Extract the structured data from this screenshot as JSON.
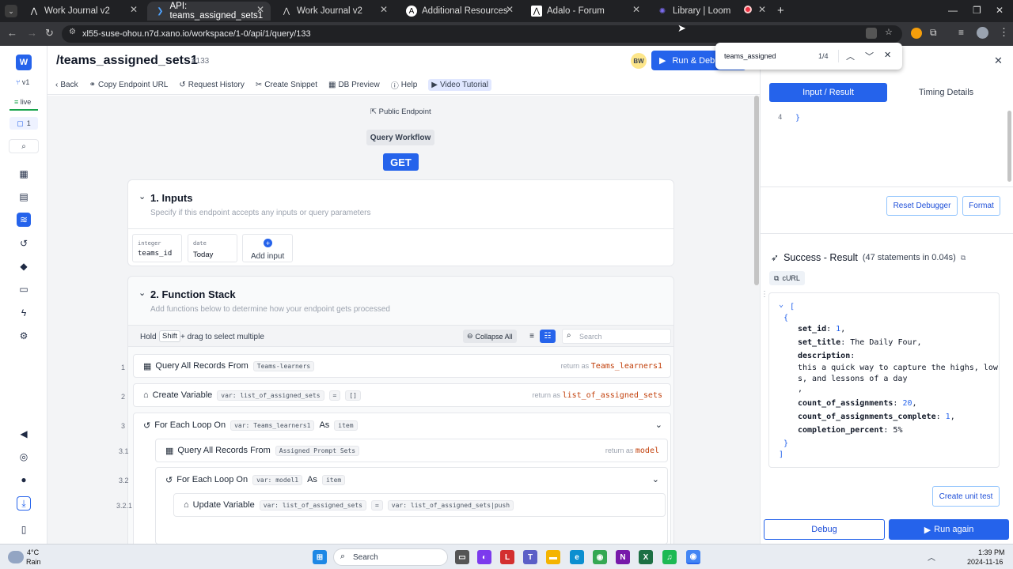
{
  "browser": {
    "tabs": [
      {
        "title": "Work Journal v2",
        "icon": "adalo-icon"
      },
      {
        "title": "API: teams_assigned_sets1",
        "icon": "xano-icon",
        "active": true
      },
      {
        "title": "Work Journal v2",
        "icon": "adalo-icon"
      },
      {
        "title": "Additional Resources | Adalo R",
        "icon": "adalo-icon"
      },
      {
        "title": "Adalo - Forum",
        "icon": "adalo-icon"
      },
      {
        "title": "Library | Loom",
        "icon": "loom-icon"
      }
    ],
    "url": "xl55-suse-ohou.n7d.xano.io/workspace/1-0/api/1/query/133"
  },
  "find": {
    "query": "teams_assigned",
    "count": "1/4"
  },
  "sidebar": {
    "workspace_letter": "W",
    "version": "v1",
    "status": "live",
    "badge_count": "1"
  },
  "header": {
    "title": "/teams_assigned_sets1",
    "id": "#133",
    "avatar": "BW",
    "run_debug": "Run & Debug"
  },
  "toolbar": {
    "back": "Back",
    "copy": "Copy Endpoint URL",
    "history": "Request History",
    "snippet": "Create Snippet",
    "db": "DB Preview",
    "help": "Help",
    "video": "Video Tutorial"
  },
  "canvas": {
    "public": "Public Endpoint",
    "workflow": "Query Workflow",
    "method": "GET",
    "inputs": {
      "title": "1. Inputs",
      "subtitle": "Specify if this endpoint accepts any inputs or query parameters",
      "fields": [
        {
          "type": "integer",
          "name": "teams_id"
        },
        {
          "type": "date",
          "name": "Today"
        }
      ],
      "add": "Add input"
    },
    "stack": {
      "title": "2. Function Stack",
      "subtitle": "Add functions below to determine how your endpoint gets processed",
      "hold": "Hold",
      "shift": "Shift",
      "drag": "+ drag to select multiple",
      "collapse": "Collapse All",
      "search_placeholder": "Search",
      "rows": [
        {
          "n": "1",
          "label": "Query All Records From",
          "tag": "Teams-learners",
          "ret": "return as",
          "retval": "Teams_learners1"
        },
        {
          "n": "2",
          "label": "Create Variable",
          "tag": "var: list_of_assigned_sets",
          "eq": "=",
          "tag2": "[]",
          "ret": "return as",
          "retval": "list_of_assigned_sets"
        },
        {
          "n": "3",
          "label": "For Each Loop On",
          "tag": "var: Teams_learners1",
          "as": "As",
          "tag2": "item"
        },
        {
          "n": "3.1",
          "label": "Query All Records From",
          "tag": "Assigned Prompt Sets",
          "ret": "return as",
          "retval": "model"
        },
        {
          "n": "3.2",
          "label": "For Each Loop On",
          "tag": "var: model1",
          "as": "As",
          "tag2": "item"
        },
        {
          "n": "3.2.1",
          "label": "Update Variable",
          "tag": "var: list_of_assigned_sets",
          "eq": "=",
          "tag2": "var: list_of_assigned_sets|push"
        }
      ]
    }
  },
  "panel": {
    "tab_input": "Input / Result",
    "tab_timing": "Timing Details",
    "code_line": "4",
    "code_text": "}",
    "reset": "Reset Debugger",
    "format": "Format",
    "success": "Success - Result",
    "stats": "(47 statements in 0.04s)",
    "curl": "cURL",
    "json": {
      "set_id_key": "set_id",
      "set_id": "1",
      "set_title_key": "set_title",
      "set_title": "The Daily Four,",
      "desc_key": "description",
      "desc1": "this a quick way to capture the highs, low",
      "desc2": "s, and lessons of a day",
      "coa_key": "count_of_assignments",
      "coa": "20",
      "coac_key": "count_of_assignments_complete",
      "coac": "1",
      "cp_key": "completion_percent",
      "cp": "5%"
    },
    "create_test": "Create unit test",
    "debug": "Debug",
    "run_again": "Run again"
  },
  "taskbar": {
    "temp": "4°C",
    "weather": "Rain",
    "search": "Search",
    "time": "1:39 PM",
    "date": "2024-11-16"
  }
}
